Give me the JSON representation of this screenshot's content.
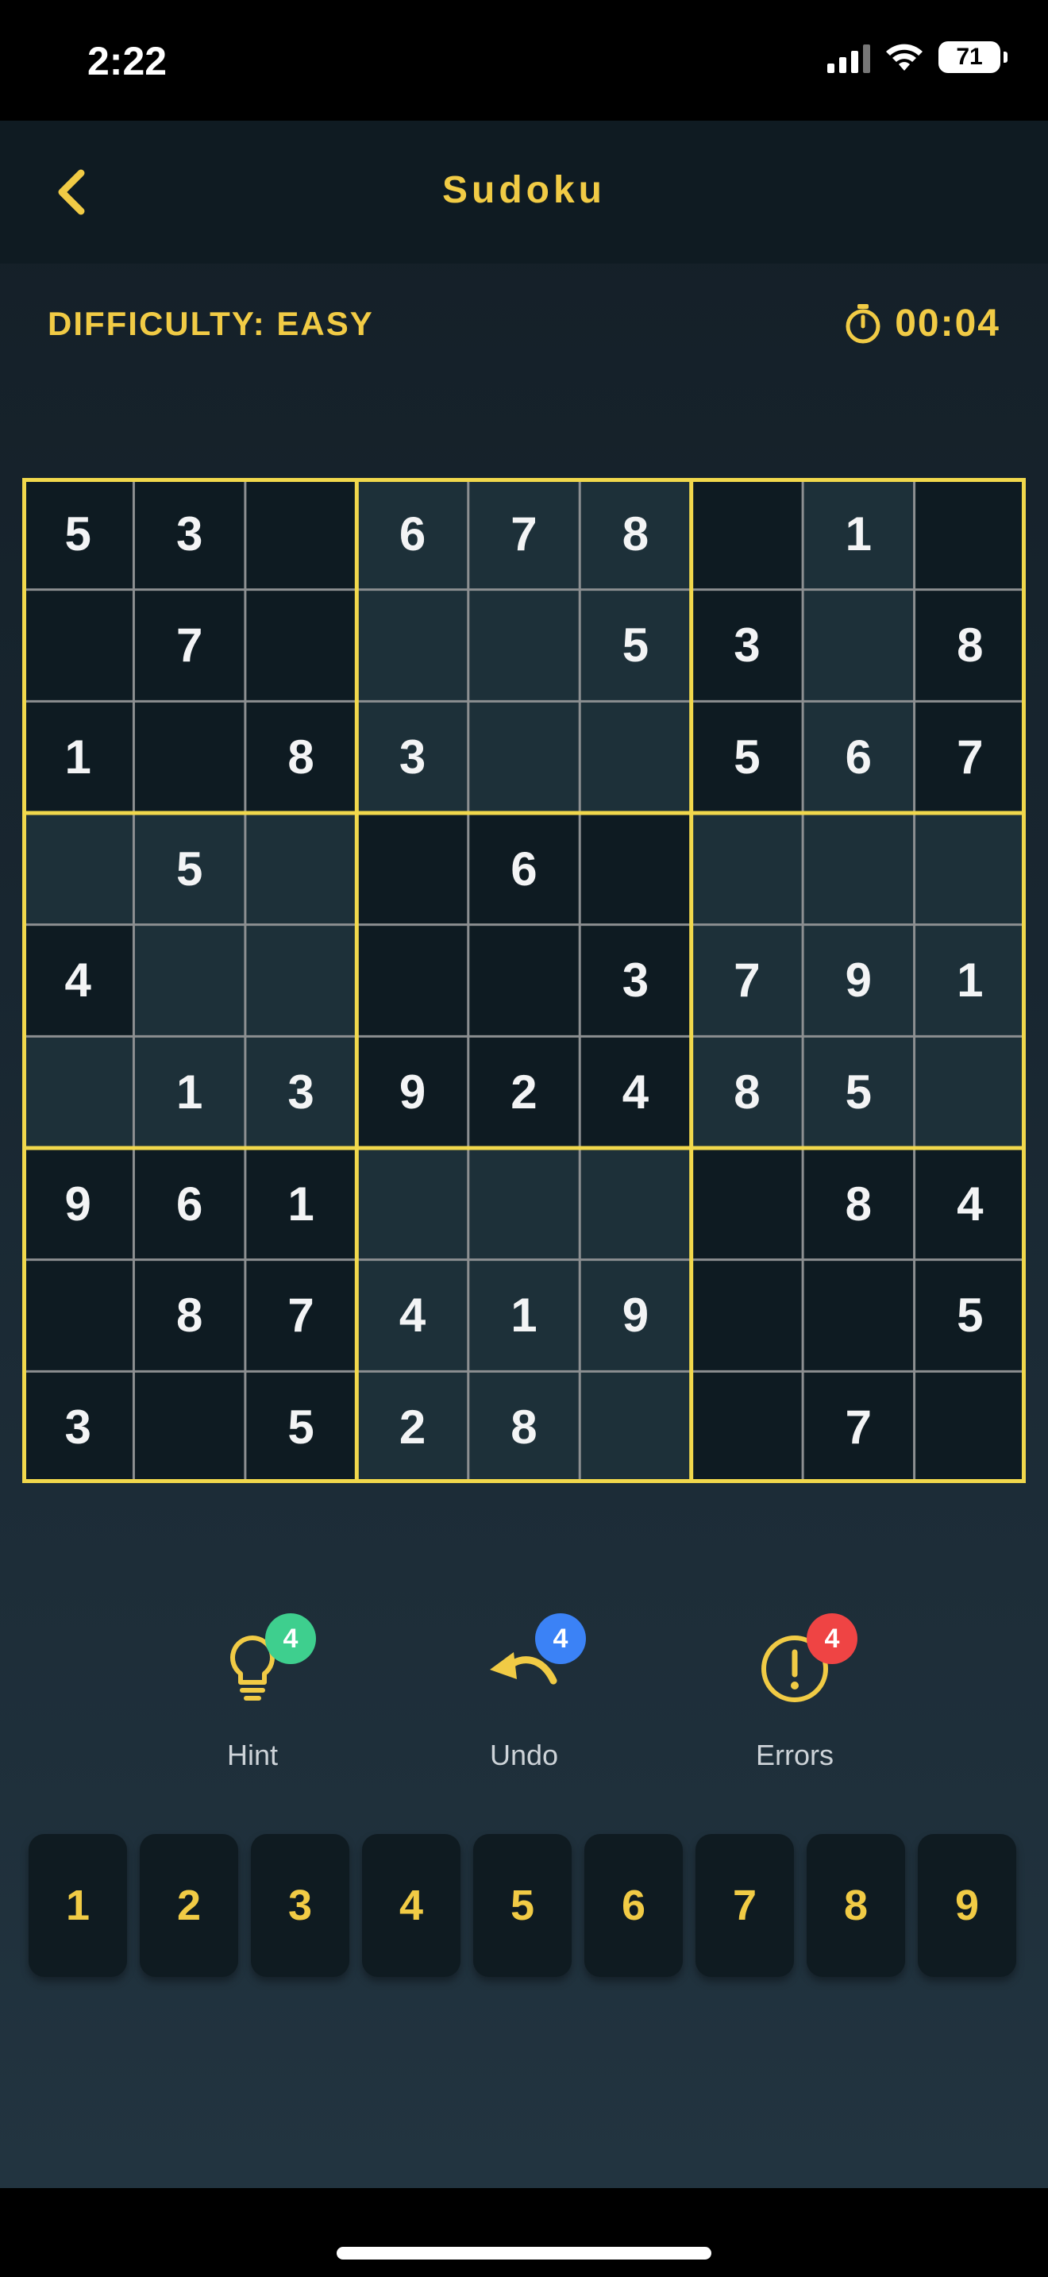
{
  "status_bar": {
    "time": "2:22",
    "battery": "71"
  },
  "nav": {
    "title": "Sudoku",
    "back_icon": "chevron-left-icon"
  },
  "info": {
    "difficulty": "DIFFICULTY: EASY",
    "timer": "00:04",
    "timer_icon": "stopwatch-icon"
  },
  "board": {
    "rows": [
      [
        "5",
        "3",
        "",
        "6",
        "7",
        "8",
        "",
        "1",
        ""
      ],
      [
        "",
        "7",
        "",
        "",
        "",
        "5",
        "3",
        "",
        "8"
      ],
      [
        "1",
        "",
        "8",
        "3",
        "",
        "",
        "5",
        "6",
        "7"
      ],
      [
        "",
        "5",
        "",
        "",
        "6",
        "",
        "",
        "",
        ""
      ],
      [
        "4",
        "",
        "",
        "",
        "",
        "3",
        "7",
        "9",
        "1"
      ],
      [
        "",
        "1",
        "3",
        "9",
        "2",
        "4",
        "8",
        "5",
        ""
      ],
      [
        "9",
        "6",
        "1",
        "",
        "",
        "",
        "",
        "8",
        "4"
      ],
      [
        "",
        "8",
        "7",
        "4",
        "1",
        "9",
        "",
        "",
        "5"
      ],
      [
        "3",
        "",
        "5",
        "2",
        "8",
        "",
        "",
        "7",
        ""
      ]
    ],
    "shades": [
      [
        "dark",
        "dark",
        "dark",
        "light",
        "light",
        "light",
        "dark",
        "light",
        "dark"
      ],
      [
        "dark",
        "dark",
        "dark",
        "light",
        "light",
        "light",
        "dark",
        "light",
        "dark"
      ],
      [
        "dark",
        "dark",
        "dark",
        "light",
        "light",
        "light",
        "dark",
        "light",
        "dark"
      ],
      [
        "light",
        "light",
        "light",
        "dark",
        "dark",
        "dark",
        "light",
        "light",
        "light"
      ],
      [
        "dark",
        "light",
        "light",
        "dark",
        "dark",
        "dark",
        "light",
        "light",
        "light"
      ],
      [
        "light",
        "light",
        "light",
        "dark",
        "dark",
        "dark",
        "light",
        "light",
        "light"
      ],
      [
        "dark",
        "dark",
        "dark",
        "light",
        "light",
        "light",
        "dark",
        "dark",
        "dark"
      ],
      [
        "dark",
        "dark",
        "dark",
        "light",
        "light",
        "light",
        "dark",
        "dark",
        "dark"
      ],
      [
        "dark",
        "dark",
        "dark",
        "light",
        "light",
        "light",
        "dark",
        "dark",
        "dark"
      ]
    ],
    "grid_color": "#8c8f91",
    "box_border_color": "#f1d84c"
  },
  "actions": [
    {
      "label": "Hint",
      "count": "4",
      "icon": "lightbulb-icon",
      "badge_color": "#3ecf8e"
    },
    {
      "label": "Undo",
      "count": "4",
      "icon": "undo-icon",
      "badge_color": "#3b82f6"
    },
    {
      "label": "Errors",
      "count": "4",
      "icon": "alert-circle-icon",
      "badge_color": "#ef4444"
    }
  ],
  "numpad": [
    "1",
    "2",
    "3",
    "4",
    "5",
    "6",
    "7",
    "8",
    "9"
  ],
  "colors": {
    "accent": "#f1cb45",
    "cell_text": "#f3f4f5"
  }
}
